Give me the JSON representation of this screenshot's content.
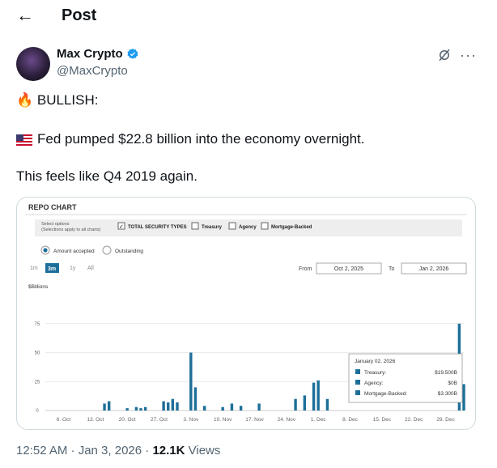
{
  "header": {
    "back_icon": "arrow-left-icon",
    "title": "Post"
  },
  "author": {
    "name": "Max Crypto",
    "handle": "@MaxCrypto",
    "verified_color": "#1d9bf0"
  },
  "tweet": {
    "line1_emoji": "🔥",
    "line1": "BULLISH:",
    "line2": "Fed pumped $22.8 billion into the economy overnight.",
    "line3": "This feels like Q4 2019 again."
  },
  "chart_ui": {
    "title": "REPO CHART",
    "select_label_1": "Select options",
    "select_label_2": "(Selections apply to all charts)",
    "checkboxes": [
      "TOTAL SECURITY TYPES",
      "Treasury",
      "Agency",
      "Mortgage-Backed"
    ],
    "radios": [
      "Amount accepted",
      "Outstanding"
    ],
    "ranges": [
      "1m",
      "3m",
      "1y",
      "All"
    ],
    "selected_range": "3m",
    "from_label": "From",
    "from_value": "Oct 2, 2025",
    "to_label": "To",
    "to_value": "Jan 2, 2026",
    "y_unit": "$Billions",
    "bar_color": "#1d6f99"
  },
  "chart_data": {
    "type": "bar",
    "ylabel": "$Billions",
    "ylim": [
      0,
      100
    ],
    "yticks": [
      0,
      25,
      50,
      75
    ],
    "xticks": [
      "6. Oct",
      "13. Oct",
      "20. Oct",
      "27. Oct",
      "3. Nov",
      "10. Nov",
      "17. Nov",
      "24. Nov",
      "1. Dec",
      "8. Dec",
      "15. Dec",
      "22. Dec",
      "29. Dec"
    ],
    "x_start": "2025-10-02",
    "x_end": "2026-01-02",
    "bars": [
      {
        "date": "2025-10-15",
        "value": 6.0
      },
      {
        "date": "2025-10-16",
        "value": 8.0
      },
      {
        "date": "2025-10-20",
        "value": 2.0
      },
      {
        "date": "2025-10-22",
        "value": 3.0
      },
      {
        "date": "2025-10-23",
        "value": 2.0
      },
      {
        "date": "2025-10-24",
        "value": 3.0
      },
      {
        "date": "2025-10-28",
        "value": 8.0
      },
      {
        "date": "2025-10-29",
        "value": 7.0
      },
      {
        "date": "2025-10-30",
        "value": 10.0
      },
      {
        "date": "2025-10-31",
        "value": 7.0
      },
      {
        "date": "2025-11-03",
        "value": 50.0
      },
      {
        "date": "2025-11-04",
        "value": 20.0
      },
      {
        "date": "2025-11-06",
        "value": 4.0
      },
      {
        "date": "2025-11-10",
        "value": 3.0
      },
      {
        "date": "2025-11-12",
        "value": 6.0
      },
      {
        "date": "2025-11-14",
        "value": 4.0
      },
      {
        "date": "2025-11-18",
        "value": 6.0
      },
      {
        "date": "2025-11-26",
        "value": 10.0
      },
      {
        "date": "2025-11-28",
        "value": 13.0
      },
      {
        "date": "2025-11-30",
        "value": 24.0
      },
      {
        "date": "2025-12-01",
        "value": 26.0
      },
      {
        "date": "2025-12-03",
        "value": 10.0
      },
      {
        "date": "2026-01-01",
        "value": 75.0
      },
      {
        "date": "2026-01-02",
        "value": 22.8
      }
    ],
    "tooltip": {
      "date": "January 02, 2026",
      "rows": [
        {
          "label": "Treasury:",
          "value": "$19.500B"
        },
        {
          "label": "Agency:",
          "value": "$0B"
        },
        {
          "label": "Mortgage-Backed:",
          "value": "$3.300B"
        }
      ]
    }
  },
  "footer": {
    "time": "12:52 AM · Jan 3, 2026 · ",
    "views": "12.1K",
    "views_label": " Views"
  }
}
